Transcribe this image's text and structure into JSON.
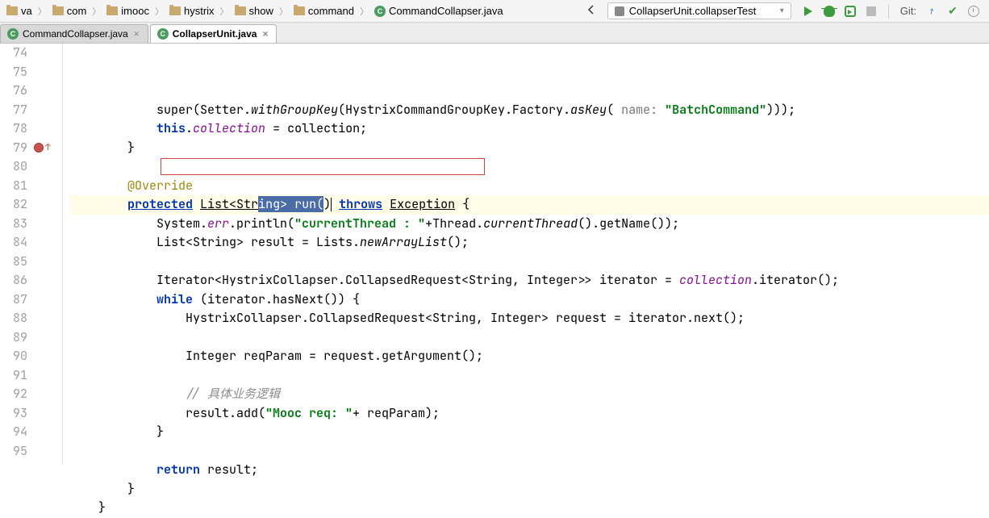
{
  "breadcrumbs": [
    {
      "type": "folder",
      "label": "va"
    },
    {
      "type": "folder",
      "label": "com"
    },
    {
      "type": "folder",
      "label": "imooc"
    },
    {
      "type": "folder",
      "label": "hystrix"
    },
    {
      "type": "folder",
      "label": "show"
    },
    {
      "type": "folder",
      "label": "command"
    },
    {
      "type": "class",
      "label": "CommandCollapser.java"
    }
  ],
  "runConfig": {
    "label": "CollapserUnit.collapserTest"
  },
  "git": {
    "label": "Git:"
  },
  "tabs": [
    {
      "label": "CommandCollapser.java",
      "active": false,
      "icon": "class"
    },
    {
      "label": "CollapserUnit.java",
      "active": true,
      "icon": "class"
    }
  ],
  "lines": [
    {
      "n": "74",
      "code": "            super(Setter.<span class='static method-call'>withGroupKey</span>(HystrixCommandGroupKey.Factory.<span class='static method-call'>asKey</span>( <span class='param-hint'>name:</span> <span class='str'>\"BatchCommand\"</span>)));"
    },
    {
      "n": "75",
      "code": "            <span class='kw'>this</span>.<span class='field'>collection</span> = collection;"
    },
    {
      "n": "76",
      "code": "        }"
    },
    {
      "n": "77",
      "code": ""
    },
    {
      "n": "78",
      "code": "        <span class='anno'>@Override</span>"
    },
    {
      "n": "79",
      "code": "        <span class='kw underline'>protected</span> <span class='underline'>List&lt;Str</span><span class='sel'>ing&gt; run(</span>)<span class='caret'></span> <span class='kw underline'>throws</span> <span class='underline'>Exception</span> {",
      "current": true,
      "bp": true
    },
    {
      "n": "80",
      "code": "            System.<span class='field'>err</span>.println(<span class='str'>\"currentThread : \"</span>+Thread.<span class='static method-call'>currentThread</span>().getName());"
    },
    {
      "n": "81",
      "code": "            List&lt;String&gt; result = Lists.<span class='static method-call'>newArrayList</span>();"
    },
    {
      "n": "82",
      "code": ""
    },
    {
      "n": "83",
      "code": "            Iterator&lt;HystrixCollapser.CollapsedRequest&lt;String, Integer&gt;&gt; iterator = <span class='field'>collection</span>.iterator();"
    },
    {
      "n": "84",
      "code": "            <span class='kw'>while</span> (iterator.hasNext()) {"
    },
    {
      "n": "85",
      "code": "                HystrixCollapser.CollapsedRequest&lt;String, Integer&gt; request = iterator.next();"
    },
    {
      "n": "86",
      "code": ""
    },
    {
      "n": "87",
      "code": "                Integer reqParam = request.getArgument();"
    },
    {
      "n": "88",
      "code": ""
    },
    {
      "n": "89",
      "code": "                <span class='comment'>// 具体业务逻辑</span>"
    },
    {
      "n": "90",
      "code": "                result.add(<span class='str'>\"Mooc req: \"</span>+ reqParam);"
    },
    {
      "n": "91",
      "code": "            }"
    },
    {
      "n": "92",
      "code": ""
    },
    {
      "n": "93",
      "code": "            <span class='kw'>return</span> result;"
    },
    {
      "n": "94",
      "code": "        }"
    },
    {
      "n": "95",
      "code": "    }"
    }
  ]
}
